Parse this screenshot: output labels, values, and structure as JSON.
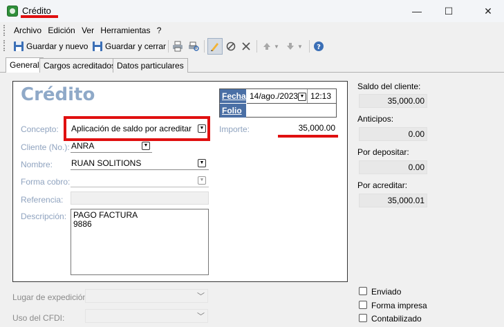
{
  "window": {
    "title": "Crédito",
    "controls": {
      "minimize": "—",
      "maximize": "☐",
      "close": "✕"
    },
    "icon": "credit-app-icon"
  },
  "menu": {
    "items": [
      "Archivo",
      "Edición",
      "Ver",
      "Herramientas",
      "?"
    ]
  },
  "toolbar": {
    "save_new_label": "Guardar y nuevo",
    "save_close_label": "Guardar y cerrar",
    "icons": [
      "save-icon",
      "save-close-icon",
      "print-icon",
      "print-preview-icon",
      "edit-pencil-icon",
      "cancel-circle-icon",
      "delete-x-icon",
      "arrow-up-icon",
      "arrow-down-icon",
      "help-icon"
    ]
  },
  "tabs": [
    {
      "label": "General",
      "active": true
    },
    {
      "label": "Cargos acreditados",
      "active": false
    },
    {
      "label": "Datos particulares",
      "active": false
    }
  ],
  "form": {
    "heading": "Crédito",
    "concepto": {
      "label": "Concepto:",
      "value": "Aplicación de saldo por acreditar"
    },
    "cliente": {
      "label": "Cliente (No.):",
      "value": "ANRA"
    },
    "nombre": {
      "label": "Nombre:",
      "value": "RUAN SOLITIONS"
    },
    "forma_cobro": {
      "label": "Forma cobro:",
      "value": ""
    },
    "referencia": {
      "label": "Referencia:",
      "value": ""
    },
    "descripcion": {
      "label": "Descripción:",
      "line1": "PAGO FACTURA",
      "line2": "9886"
    },
    "fecha": {
      "label": "Fecha",
      "date": "14/ago./2023",
      "time": "12:13"
    },
    "folio": {
      "label": "Folio",
      "value": ""
    },
    "importe": {
      "label": "Importe:",
      "value": "35,000.00"
    }
  },
  "bottom": {
    "lugar_label": "Lugar de expedición:",
    "cfdi_label": "Uso del CFDI:"
  },
  "summary": {
    "saldo_label": "Saldo del cliente:",
    "saldo_value": "35,000.00",
    "anticipos_label": "Anticipos:",
    "anticipos_value": "0.00",
    "por_depositar_label": "Por depositar:",
    "por_depositar_value": "0.00",
    "por_acreditar_label": "Por acreditar:",
    "por_acreditar_value": "35,000.01"
  },
  "checks": {
    "enviado": "Enviado",
    "forma_impresa": "Forma impresa",
    "contabilizado": "Contabilizado"
  },
  "colors": {
    "accent_red": "#e01010",
    "label_blue": "#8fa3bf",
    "header_blue": "#4a6fa5",
    "heading_blue": "#8fa9c8"
  }
}
